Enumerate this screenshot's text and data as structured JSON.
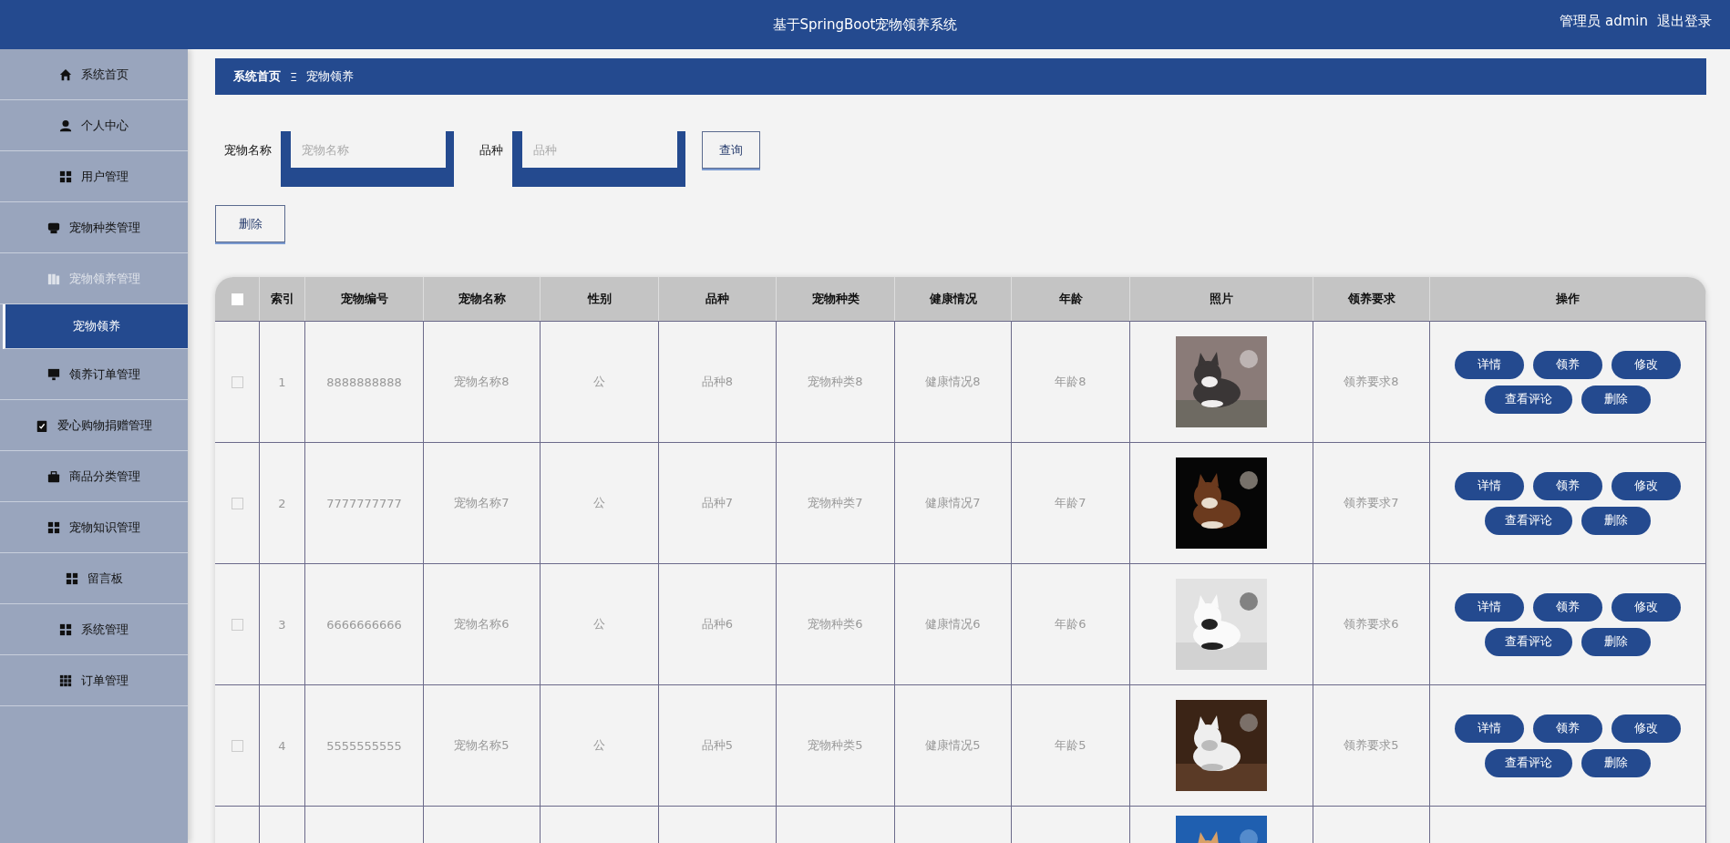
{
  "header": {
    "title": "基于SpringBoot宠物领养系统",
    "user": "管理员 admin",
    "logout": "退出登录"
  },
  "sidebar": {
    "items": [
      {
        "label": "系统首页",
        "expanded": false
      },
      {
        "label": "个人中心",
        "expanded": false
      },
      {
        "label": "用户管理",
        "expanded": false
      },
      {
        "label": "宠物种类管理",
        "expanded": false
      },
      {
        "label": "宠物领养管理",
        "expanded": true,
        "children": [
          {
            "label": "宠物领养",
            "selected": true
          }
        ]
      },
      {
        "label": "领养订单管理",
        "expanded": false
      },
      {
        "label": "爱心购物捐赠管理",
        "expanded": false
      },
      {
        "label": "商品分类管理",
        "expanded": false
      },
      {
        "label": "宠物知识管理",
        "expanded": false
      },
      {
        "label": "留言板",
        "expanded": false
      },
      {
        "label": "系统管理",
        "expanded": false
      },
      {
        "label": "订单管理",
        "expanded": false
      }
    ]
  },
  "breadcrumb": {
    "home": "系统首页",
    "separator": "Ξ",
    "current": "宠物领养"
  },
  "search": {
    "fields": [
      {
        "label": "宠物名称",
        "placeholder": "宠物名称"
      },
      {
        "label": "品种",
        "placeholder": "品种"
      }
    ],
    "button": "查询"
  },
  "delete_button": "删除",
  "table": {
    "select_all": {
      "checked": false
    },
    "columns": [
      "索引",
      "宠物编号",
      "宠物名称",
      "性别",
      "品种",
      "宠物种类",
      "健康情况",
      "年龄",
      "照片",
      "领养要求",
      "操作"
    ],
    "rows": [
      {
        "checked": false,
        "cells": [
          "1",
          "8888888888",
          "宠物名称8",
          "公",
          "品种8",
          "宠物种类8",
          "健康情况8",
          "年龄8"
        ],
        "photo": {
          "kind": "picture"
        },
        "requirement": "领养要求8",
        "actions": [
          "详情",
          "领养",
          "修改",
          "查看评论",
          "删除"
        ]
      },
      {
        "checked": false,
        "cells": [
          "2",
          "7777777777",
          "宠物名称7",
          "公",
          "品种7",
          "宠物种类7",
          "健康情况7",
          "年龄7"
        ],
        "photo": {
          "kind": "picture"
        },
        "requirement": "领养要求7",
        "actions": [
          "详情",
          "领养",
          "修改",
          "查看评论",
          "删除"
        ]
      },
      {
        "checked": false,
        "cells": [
          "3",
          "6666666666",
          "宠物名称6",
          "公",
          "品种6",
          "宠物种类6",
          "健康情况6",
          "年龄6"
        ],
        "photo": {
          "kind": "picture"
        },
        "requirement": "领养要求6",
        "actions": [
          "详情",
          "领养",
          "修改",
          "查看评论",
          "删除"
        ]
      },
      {
        "checked": false,
        "cells": [
          "4",
          "5555555555",
          "宠物名称5",
          "公",
          "品种5",
          "宠物种类5",
          "健康情况5",
          "年龄5"
        ],
        "photo": {
          "kind": "picture"
        },
        "requirement": "领养要求5",
        "actions": [
          "详情",
          "领养",
          "修改",
          "查看评论",
          "删除"
        ]
      }
    ],
    "cut_row": {
      "photo": {
        "kind": "picture"
      }
    }
  }
}
